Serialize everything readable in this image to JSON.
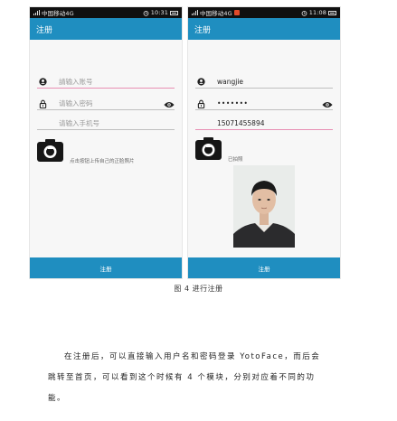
{
  "phone_left": {
    "status_left": "中国移动4G",
    "status_time": "10:31",
    "title": "注册",
    "account_placeholder": "請输入账号",
    "password_placeholder": "请输入密码",
    "phone_placeholder": "请输入手机号",
    "camera_hint": "点击按钮上传自己的正脸照片",
    "submit_label": "注册"
  },
  "phone_right": {
    "status_left": "中国移动4G",
    "status_time": "11:08",
    "title": "注册",
    "account_value": "wangjie",
    "password_value": "•••••••",
    "phone_value": "15071455894",
    "camera_status": "已拍照",
    "submit_label": "注册"
  },
  "figure_caption": "图 4  进行注册",
  "paragraph_lines": [
    "在注册后，可以直接输入用户名和密码登录 YotoFace，而后会",
    "跳转至首页，可以看到这个时候有 4 个模块，分别对应着不同的功",
    "能。"
  ],
  "colors": {
    "accent": "#1f8ec0",
    "active_underline": "#e88fb3",
    "status_bar": "#101010"
  },
  "icons": [
    "user-icon",
    "lock-icon",
    "eye-icon",
    "camera-icon",
    "signal-icon",
    "battery-icon",
    "alarm-icon"
  ]
}
